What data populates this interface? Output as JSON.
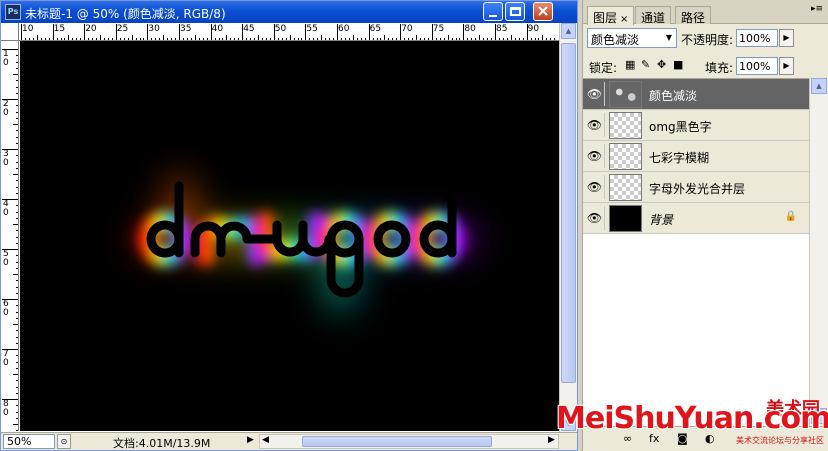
{
  "window": {
    "title": "未标题-1 @ 50% (颜色减淡, RGB/8)",
    "app_icon": "Ps"
  },
  "rulers": {
    "horizontal_labels": [
      "10",
      "15",
      "20",
      "25",
      "30",
      "35",
      "40",
      "45",
      "50",
      "55",
      "60",
      "65",
      "70",
      "75",
      "80",
      "85",
      "90"
    ],
    "vertical_labels": [
      "10",
      "20",
      "30",
      "40",
      "50",
      "60",
      "70",
      "80"
    ]
  },
  "canvas": {
    "artwork_text": "omgod",
    "background": "#000000"
  },
  "status": {
    "zoom": "50%",
    "doc_info": "文档:4.01M/13.9M"
  },
  "panel": {
    "tabs": [
      {
        "label": "图层",
        "active": true,
        "close": "×"
      },
      {
        "label": "通道",
        "active": false
      },
      {
        "label": "路径",
        "active": false
      }
    ],
    "blend_mode": "颜色减淡",
    "opacity_label": "不透明度:",
    "opacity_value": "100%",
    "lock_label": "锁定:",
    "fill_label": "填充:",
    "fill_value": "100%",
    "layers": [
      {
        "name": "颜色减淡",
        "thumb": "noise",
        "selected": true,
        "visible": true
      },
      {
        "name": "omg黑色字",
        "thumb": "checker",
        "selected": false,
        "visible": true
      },
      {
        "name": "七彩字模糊",
        "thumb": "checker",
        "selected": false,
        "visible": true
      },
      {
        "name": "字母外发光合并层",
        "thumb": "checker",
        "selected": false,
        "visible": true
      },
      {
        "name": "背景",
        "thumb": "black",
        "selected": false,
        "visible": true,
        "locked": true
      }
    ]
  },
  "watermark": {
    "main": "MeiShuYuan.com",
    "cn": "美术园",
    "sub": "美术交流论坛与分享社区"
  },
  "colors": {
    "titlebar": "#0a4fd4",
    "selected_layer": "#646464",
    "watermark": "#e0151b"
  }
}
